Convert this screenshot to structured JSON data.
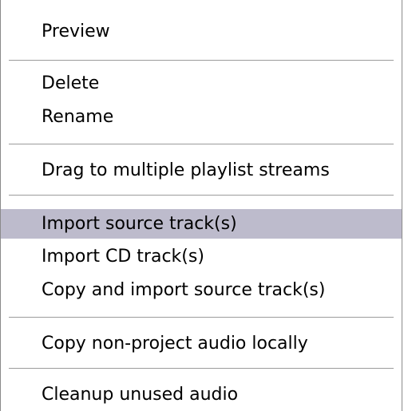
{
  "menu": {
    "items": [
      {
        "label": "Preview"
      },
      {
        "label": "Delete"
      },
      {
        "label": "Rename"
      },
      {
        "label": "Drag to multiple playlist streams"
      },
      {
        "label": "Import source track(s)"
      },
      {
        "label": "Import CD track(s)"
      },
      {
        "label": "Copy and import source track(s)"
      },
      {
        "label": "Copy non-project audio locally"
      },
      {
        "label": "Cleanup unused audio"
      }
    ],
    "highlight_color": "#bdbbcc"
  }
}
